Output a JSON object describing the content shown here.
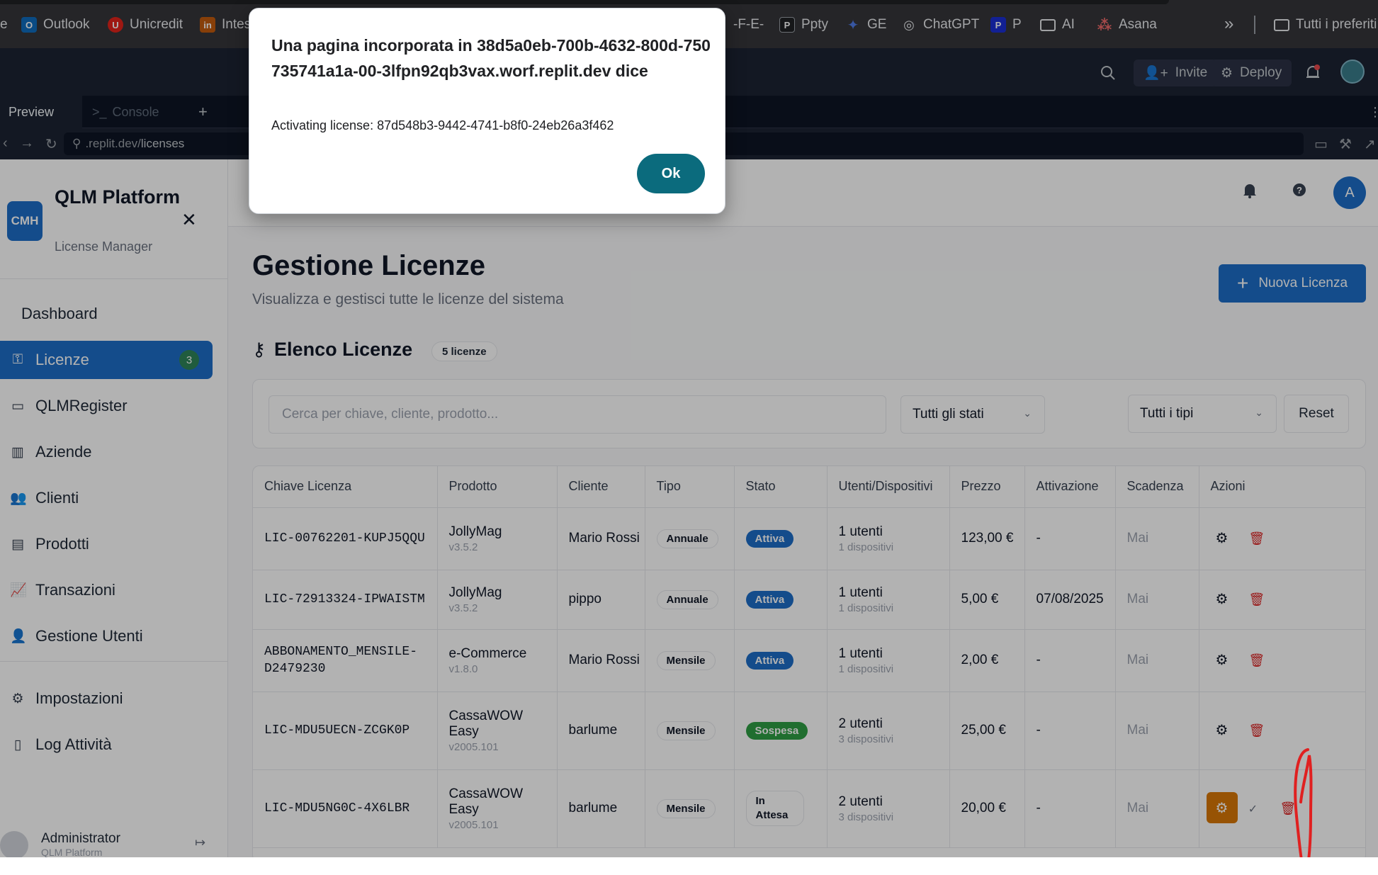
{
  "bookmarks": [
    {
      "label": "e",
      "icon": "",
      "color": ""
    },
    {
      "label": "Outlook",
      "icon": "O",
      "color": "#0f6cbd"
    },
    {
      "label": "Unicredit",
      "icon": "U",
      "color": "#e2231a"
    },
    {
      "label": "Intes",
      "icon": "in",
      "color": "#c25b0e"
    },
    {
      "label": "-F-E-",
      "icon": "",
      "color": ""
    },
    {
      "label": "Ppty",
      "icon": "P",
      "color": "#202124"
    },
    {
      "label": "GE",
      "icon": "✦",
      "color": "#4f7be8"
    },
    {
      "label": "ChatGPT",
      "icon": "◎",
      "color": "#303134"
    },
    {
      "label": "P",
      "icon": "P",
      "color": "#1a2fd4"
    },
    {
      "label": "AI",
      "icon": "▭",
      "color": "#35363a"
    },
    {
      "label": "Asana",
      "icon": "●",
      "color": "#f06a6a"
    },
    {
      "label": "»",
      "icon": "",
      "color": ""
    },
    {
      "label": "Tutti i preferiti",
      "icon": "▭",
      "color": "#35363a"
    }
  ],
  "replit": {
    "invite_label": "Invite",
    "deploy_label": "Deploy",
    "tabs": [
      "Preview",
      "Console",
      "+"
    ],
    "url_prefix": ".replit.dev/",
    "url_path": "licenses"
  },
  "brand": {
    "logo": "CMH",
    "title": "QLM Platform",
    "subtitle": "License Manager"
  },
  "nav": [
    {
      "label": "Dashboard",
      "icon": ""
    },
    {
      "label": "Licenze",
      "icon": "key-icon",
      "badge": "3",
      "active": true
    },
    {
      "label": "QLMRegister",
      "icon": "monitor-icon"
    },
    {
      "label": "Aziende",
      "icon": "building-icon"
    },
    {
      "label": "Clienti",
      "icon": "users-icon"
    },
    {
      "label": "Prodotti",
      "icon": "box-icon"
    },
    {
      "label": "Transazioni",
      "icon": "chart-icon"
    },
    {
      "label": "Gestione Utenti",
      "icon": "user-cog-icon"
    },
    {
      "label": "Impostazioni",
      "icon": "gear-icon"
    },
    {
      "label": "Log Attività",
      "icon": "file-icon"
    }
  ],
  "user": {
    "name": "Administrator",
    "role": "QLM Platform"
  },
  "header": {
    "avatar_letter": "A"
  },
  "page": {
    "title": "Gestione Licenze",
    "subtitle": "Visualizza e gestisci tutte le licenze del sistema",
    "new_button": "Nuova Licenza",
    "list_title": "Elenco Licenze",
    "count": "5 licenze"
  },
  "filters": {
    "search_placeholder": "Cerca per chiave, cliente, prodotto...",
    "status_select": "Tutti gli stati",
    "type_select": "Tutti i tipi",
    "reset": "Reset"
  },
  "table": {
    "columns": [
      "Chiave Licenza",
      "Prodotto",
      "Cliente",
      "Tipo",
      "Stato",
      "Utenti/Dispositivi",
      "Prezzo",
      "Attivazione",
      "Scadenza",
      "Azioni"
    ],
    "rows": [
      {
        "key": "LIC-00762201-KUPJ5QQU",
        "product": "JollyMag",
        "version": "v3.5.2",
        "client": "Mario Rossi",
        "type": "Annuale",
        "status": "Attiva",
        "status_color": "#1e6ec8",
        "users": "1 utenti",
        "devices": "1 dispositivi",
        "price": "123,00 €",
        "activation": "-",
        "expiry": "Mai"
      },
      {
        "key": "LIC-72913324-IPWAISTM",
        "product": "JollyMag",
        "version": "v3.5.2",
        "client": "pippo",
        "type": "Annuale",
        "status": "Attiva",
        "status_color": "#1e6ec8",
        "users": "1 utenti",
        "devices": "1 dispositivi",
        "price": "5,00 €",
        "activation": "07/08/2025",
        "expiry": "Mai"
      },
      {
        "key": "ABBONAMENTO_MENSILE-D2479230",
        "product": "e-Commerce",
        "version": "v1.8.0",
        "client": "Mario Rossi",
        "type": "Mensile",
        "status": "Attiva",
        "status_color": "#1e6ec8",
        "users": "1 utenti",
        "devices": "1 dispositivi",
        "price": "2,00 €",
        "activation": "-",
        "expiry": "Mai"
      },
      {
        "key": "LIC-MDU5UECN-ZCGK0P",
        "product": "CassaWOW Easy",
        "version": "v2005.101",
        "client": "barlume",
        "type": "Mensile",
        "status": "Sospesa",
        "status_color": "#2f9e44",
        "users": "2 utenti",
        "devices": "3 dispositivi",
        "price": "25,00 €",
        "activation": "-",
        "expiry": "Mai"
      },
      {
        "key": "LIC-MDU5NG0C-4X6LBR",
        "product": "CassaWOW Easy",
        "version": "v2005.101",
        "client": "barlume",
        "type": "Mensile",
        "status": "In Attesa",
        "status_color": "",
        "users": "2 utenti",
        "devices": "3 dispositivi",
        "price": "20,00 €",
        "activation": "-",
        "expiry": "Mai"
      }
    ]
  },
  "dialog": {
    "title": "Una pagina incorporata in 38d5a0eb-700b-4632-800d-750735741a1a-00-3lfpn92qb3vax.worf.replit.dev dice",
    "message": "Activating license: 87d548b3-9442-4741-b8f0-24eb26a3f462",
    "ok": "Ok"
  }
}
